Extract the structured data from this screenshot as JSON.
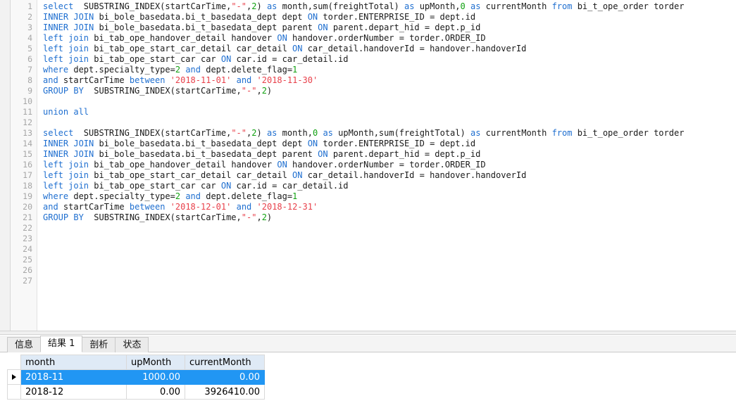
{
  "editor": {
    "line_count": 27,
    "line_numbers": [
      1,
      2,
      3,
      4,
      5,
      6,
      7,
      8,
      9,
      10,
      11,
      12,
      13,
      14,
      15,
      16,
      17,
      18,
      19,
      20,
      21,
      22,
      23,
      24,
      25,
      26,
      27
    ],
    "lines": [
      [
        {
          "t": "select",
          "c": "kw"
        },
        {
          "t": "  SUBSTRING_INDEX(startCarTime,",
          "c": "plain"
        },
        {
          "t": "\"-\"",
          "c": "str"
        },
        {
          "t": ",",
          "c": "plain"
        },
        {
          "t": "2",
          "c": "num"
        },
        {
          "t": ") ",
          "c": "plain"
        },
        {
          "t": "as",
          "c": "kw"
        },
        {
          "t": " month,sum(freightTotal) ",
          "c": "plain"
        },
        {
          "t": "as",
          "c": "kw"
        },
        {
          "t": " upMonth,",
          "c": "plain"
        },
        {
          "t": "0",
          "c": "num"
        },
        {
          "t": " ",
          "c": "plain"
        },
        {
          "t": "as",
          "c": "kw"
        },
        {
          "t": " currentMonth ",
          "c": "plain"
        },
        {
          "t": "from",
          "c": "kw"
        },
        {
          "t": " bi_t_ope_order torder",
          "c": "plain"
        }
      ],
      [
        {
          "t": "INNER JOIN",
          "c": "kw"
        },
        {
          "t": " bi_bole_basedata.bi_t_basedata_dept dept ",
          "c": "plain"
        },
        {
          "t": "ON",
          "c": "kw"
        },
        {
          "t": " torder.ENTERPRISE_ID = dept.id",
          "c": "plain"
        }
      ],
      [
        {
          "t": "INNER JOIN",
          "c": "kw"
        },
        {
          "t": " bi_bole_basedata.bi_t_basedata_dept parent ",
          "c": "plain"
        },
        {
          "t": "ON",
          "c": "kw"
        },
        {
          "t": " parent.depart_hid = dept.p_id",
          "c": "plain"
        }
      ],
      [
        {
          "t": "left join",
          "c": "kw"
        },
        {
          "t": " bi_tab_ope_handover_detail handover ",
          "c": "plain"
        },
        {
          "t": "ON",
          "c": "kw"
        },
        {
          "t": " handover.orderNumber = torder.ORDER_ID",
          "c": "plain"
        }
      ],
      [
        {
          "t": "left join",
          "c": "kw"
        },
        {
          "t": " bi_tab_ope_start_car_detail car_detail ",
          "c": "plain"
        },
        {
          "t": "ON",
          "c": "kw"
        },
        {
          "t": " car_detail.handoverId = handover.handoverId",
          "c": "plain"
        }
      ],
      [
        {
          "t": "left join",
          "c": "kw"
        },
        {
          "t": " bi_tab_ope_start_car car ",
          "c": "plain"
        },
        {
          "t": "ON",
          "c": "kw"
        },
        {
          "t": " car.id = car_detail.id",
          "c": "plain"
        }
      ],
      [
        {
          "t": "where",
          "c": "kw"
        },
        {
          "t": " dept.specialty_type=",
          "c": "plain"
        },
        {
          "t": "2",
          "c": "num"
        },
        {
          "t": " ",
          "c": "plain"
        },
        {
          "t": "and",
          "c": "kw"
        },
        {
          "t": " dept.delete_flag=",
          "c": "plain"
        },
        {
          "t": "1",
          "c": "num"
        }
      ],
      [
        {
          "t": "and",
          "c": "kw"
        },
        {
          "t": " startCarTime ",
          "c": "plain"
        },
        {
          "t": "between",
          "c": "kw"
        },
        {
          "t": " ",
          "c": "plain"
        },
        {
          "t": "'2018-11-01'",
          "c": "str"
        },
        {
          "t": " ",
          "c": "plain"
        },
        {
          "t": "and",
          "c": "kw"
        },
        {
          "t": " ",
          "c": "plain"
        },
        {
          "t": "'2018-11-30'",
          "c": "str"
        }
      ],
      [
        {
          "t": "GROUP BY",
          "c": "kw"
        },
        {
          "t": "  SUBSTRING_INDEX(startCarTime,",
          "c": "plain"
        },
        {
          "t": "\"-\"",
          "c": "str"
        },
        {
          "t": ",",
          "c": "plain"
        },
        {
          "t": "2",
          "c": "num"
        },
        {
          "t": ")",
          "c": "plain"
        }
      ],
      [],
      [
        {
          "t": "union all",
          "c": "kw"
        }
      ],
      [],
      [
        {
          "t": "select",
          "c": "kw"
        },
        {
          "t": "  SUBSTRING_INDEX(startCarTime,",
          "c": "plain"
        },
        {
          "t": "\"-\"",
          "c": "str"
        },
        {
          "t": ",",
          "c": "plain"
        },
        {
          "t": "2",
          "c": "num"
        },
        {
          "t": ") ",
          "c": "plain"
        },
        {
          "t": "as",
          "c": "kw"
        },
        {
          "t": " month,",
          "c": "plain"
        },
        {
          "t": "0",
          "c": "num"
        },
        {
          "t": " ",
          "c": "plain"
        },
        {
          "t": "as",
          "c": "kw"
        },
        {
          "t": " upMonth,sum(freightTotal) ",
          "c": "plain"
        },
        {
          "t": "as",
          "c": "kw"
        },
        {
          "t": " currentMonth ",
          "c": "plain"
        },
        {
          "t": "from",
          "c": "kw"
        },
        {
          "t": " bi_t_ope_order torder",
          "c": "plain"
        }
      ],
      [
        {
          "t": "INNER JOIN",
          "c": "kw"
        },
        {
          "t": " bi_bole_basedata.bi_t_basedata_dept dept ",
          "c": "plain"
        },
        {
          "t": "ON",
          "c": "kw"
        },
        {
          "t": " torder.ENTERPRISE_ID = dept.id",
          "c": "plain"
        }
      ],
      [
        {
          "t": "INNER JOIN",
          "c": "kw"
        },
        {
          "t": " bi_bole_basedata.bi_t_basedata_dept parent ",
          "c": "plain"
        },
        {
          "t": "ON",
          "c": "kw"
        },
        {
          "t": " parent.depart_hid = dept.p_id",
          "c": "plain"
        }
      ],
      [
        {
          "t": "left join",
          "c": "kw"
        },
        {
          "t": " bi_tab_ope_handover_detail handover ",
          "c": "plain"
        },
        {
          "t": "ON",
          "c": "kw"
        },
        {
          "t": " handover.orderNumber = torder.ORDER_ID",
          "c": "plain"
        }
      ],
      [
        {
          "t": "left join",
          "c": "kw"
        },
        {
          "t": " bi_tab_ope_start_car_detail car_detail ",
          "c": "plain"
        },
        {
          "t": "ON",
          "c": "kw"
        },
        {
          "t": " car_detail.handoverId = handover.handoverId",
          "c": "plain"
        }
      ],
      [
        {
          "t": "left join",
          "c": "kw"
        },
        {
          "t": " bi_tab_ope_start_car car ",
          "c": "plain"
        },
        {
          "t": "ON",
          "c": "kw"
        },
        {
          "t": " car.id = car_detail.id",
          "c": "plain"
        }
      ],
      [
        {
          "t": "where",
          "c": "kw"
        },
        {
          "t": " dept.specialty_type=",
          "c": "plain"
        },
        {
          "t": "2",
          "c": "num"
        },
        {
          "t": " ",
          "c": "plain"
        },
        {
          "t": "and",
          "c": "kw"
        },
        {
          "t": " dept.delete_flag=",
          "c": "plain"
        },
        {
          "t": "1",
          "c": "num"
        }
      ],
      [
        {
          "t": "and",
          "c": "kw"
        },
        {
          "t": " startCarTime ",
          "c": "plain"
        },
        {
          "t": "between",
          "c": "kw"
        },
        {
          "t": " ",
          "c": "plain"
        },
        {
          "t": "'2018-12-01'",
          "c": "str"
        },
        {
          "t": " ",
          "c": "plain"
        },
        {
          "t": "and",
          "c": "kw"
        },
        {
          "t": " ",
          "c": "plain"
        },
        {
          "t": "'2018-12-31'",
          "c": "str"
        }
      ],
      [
        {
          "t": "GROUP BY",
          "c": "kw"
        },
        {
          "t": "  SUBSTRING_INDEX(startCarTime,",
          "c": "plain"
        },
        {
          "t": "\"-\"",
          "c": "str"
        },
        {
          "t": ",",
          "c": "plain"
        },
        {
          "t": "2",
          "c": "num"
        },
        {
          "t": ")",
          "c": "plain"
        }
      ],
      [],
      [],
      [],
      [],
      [],
      []
    ]
  },
  "results_panel": {
    "tabs": [
      {
        "label": "信息",
        "active": false
      },
      {
        "label": "结果 1",
        "active": true
      },
      {
        "label": "剖析",
        "active": false
      },
      {
        "label": "状态",
        "active": false
      }
    ],
    "grid": {
      "columns": [
        "month",
        "upMonth",
        "currentMonth"
      ],
      "rows": [
        {
          "selected": true,
          "marker": true,
          "cells": [
            "2018-11",
            "1000.00",
            "0.00"
          ]
        },
        {
          "selected": false,
          "marker": false,
          "cells": [
            "2018-12",
            "0.00",
            "3926410.00"
          ]
        }
      ]
    }
  },
  "colors": {
    "keyword": "#1f6fd0",
    "number": "#11a111",
    "string": "#e8404a",
    "plain_text": "#1a1a1a",
    "grid_header_bg": "#dfeaf6",
    "row_selected_bg": "#2196f3",
    "gutter_bg": "#f8f8f8",
    "gutter_text": "#a6a6a6",
    "panel_bg": "#f4f4f4"
  }
}
